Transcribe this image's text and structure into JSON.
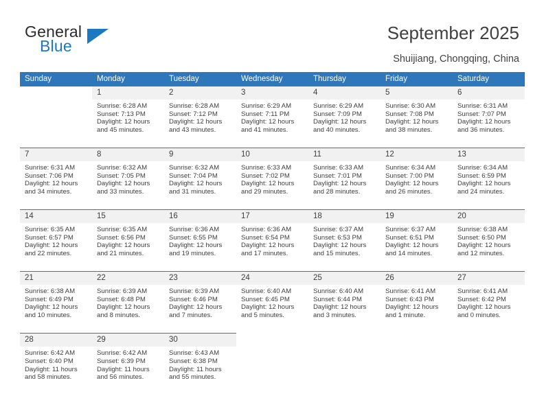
{
  "brand": {
    "name_top": "General",
    "name_bottom": "Blue"
  },
  "header": {
    "title": "September 2025",
    "subtitle": "Shuijiang, Chongqing, China"
  },
  "colors": {
    "header_blue": "#2e77bb",
    "day_band": "#f1f1f1",
    "text": "#3d3d3d"
  },
  "weekdays": [
    "Sunday",
    "Monday",
    "Tuesday",
    "Wednesday",
    "Thursday",
    "Friday",
    "Saturday"
  ],
  "labels": {
    "sunrise": "Sunrise:",
    "sunset": "Sunset:",
    "daylight": "Daylight:"
  },
  "weeks": [
    {
      "days": [
        {
          "date": "",
          "blank": true,
          "sunrise": "",
          "sunset": "",
          "daylight_1": "",
          "daylight_2": ""
        },
        {
          "date": "1",
          "sunrise": "Sunrise: 6:28 AM",
          "sunset": "Sunset: 7:13 PM",
          "daylight_1": "Daylight: 12 hours",
          "daylight_2": "and 45 minutes."
        },
        {
          "date": "2",
          "sunrise": "Sunrise: 6:28 AM",
          "sunset": "Sunset: 7:12 PM",
          "daylight_1": "Daylight: 12 hours",
          "daylight_2": "and 43 minutes."
        },
        {
          "date": "3",
          "sunrise": "Sunrise: 6:29 AM",
          "sunset": "Sunset: 7:11 PM",
          "daylight_1": "Daylight: 12 hours",
          "daylight_2": "and 41 minutes."
        },
        {
          "date": "4",
          "sunrise": "Sunrise: 6:29 AM",
          "sunset": "Sunset: 7:09 PM",
          "daylight_1": "Daylight: 12 hours",
          "daylight_2": "and 40 minutes."
        },
        {
          "date": "5",
          "sunrise": "Sunrise: 6:30 AM",
          "sunset": "Sunset: 7:08 PM",
          "daylight_1": "Daylight: 12 hours",
          "daylight_2": "and 38 minutes."
        },
        {
          "date": "6",
          "sunrise": "Sunrise: 6:31 AM",
          "sunset": "Sunset: 7:07 PM",
          "daylight_1": "Daylight: 12 hours",
          "daylight_2": "and 36 minutes."
        }
      ]
    },
    {
      "days": [
        {
          "date": "7",
          "sunrise": "Sunrise: 6:31 AM",
          "sunset": "Sunset: 7:06 PM",
          "daylight_1": "Daylight: 12 hours",
          "daylight_2": "and 34 minutes."
        },
        {
          "date": "8",
          "sunrise": "Sunrise: 6:32 AM",
          "sunset": "Sunset: 7:05 PM",
          "daylight_1": "Daylight: 12 hours",
          "daylight_2": "and 33 minutes."
        },
        {
          "date": "9",
          "sunrise": "Sunrise: 6:32 AM",
          "sunset": "Sunset: 7:04 PM",
          "daylight_1": "Daylight: 12 hours",
          "daylight_2": "and 31 minutes."
        },
        {
          "date": "10",
          "sunrise": "Sunrise: 6:33 AM",
          "sunset": "Sunset: 7:02 PM",
          "daylight_1": "Daylight: 12 hours",
          "daylight_2": "and 29 minutes."
        },
        {
          "date": "11",
          "sunrise": "Sunrise: 6:33 AM",
          "sunset": "Sunset: 7:01 PM",
          "daylight_1": "Daylight: 12 hours",
          "daylight_2": "and 28 minutes."
        },
        {
          "date": "12",
          "sunrise": "Sunrise: 6:34 AM",
          "sunset": "Sunset: 7:00 PM",
          "daylight_1": "Daylight: 12 hours",
          "daylight_2": "and 26 minutes."
        },
        {
          "date": "13",
          "sunrise": "Sunrise: 6:34 AM",
          "sunset": "Sunset: 6:59 PM",
          "daylight_1": "Daylight: 12 hours",
          "daylight_2": "and 24 minutes."
        }
      ]
    },
    {
      "days": [
        {
          "date": "14",
          "sunrise": "Sunrise: 6:35 AM",
          "sunset": "Sunset: 6:57 PM",
          "daylight_1": "Daylight: 12 hours",
          "daylight_2": "and 22 minutes."
        },
        {
          "date": "15",
          "sunrise": "Sunrise: 6:35 AM",
          "sunset": "Sunset: 6:56 PM",
          "daylight_1": "Daylight: 12 hours",
          "daylight_2": "and 21 minutes."
        },
        {
          "date": "16",
          "sunrise": "Sunrise: 6:36 AM",
          "sunset": "Sunset: 6:55 PM",
          "daylight_1": "Daylight: 12 hours",
          "daylight_2": "and 19 minutes."
        },
        {
          "date": "17",
          "sunrise": "Sunrise: 6:36 AM",
          "sunset": "Sunset: 6:54 PM",
          "daylight_1": "Daylight: 12 hours",
          "daylight_2": "and 17 minutes."
        },
        {
          "date": "18",
          "sunrise": "Sunrise: 6:37 AM",
          "sunset": "Sunset: 6:53 PM",
          "daylight_1": "Daylight: 12 hours",
          "daylight_2": "and 15 minutes."
        },
        {
          "date": "19",
          "sunrise": "Sunrise: 6:37 AM",
          "sunset": "Sunset: 6:51 PM",
          "daylight_1": "Daylight: 12 hours",
          "daylight_2": "and 14 minutes."
        },
        {
          "date": "20",
          "sunrise": "Sunrise: 6:38 AM",
          "sunset": "Sunset: 6:50 PM",
          "daylight_1": "Daylight: 12 hours",
          "daylight_2": "and 12 minutes."
        }
      ]
    },
    {
      "days": [
        {
          "date": "21",
          "sunrise": "Sunrise: 6:38 AM",
          "sunset": "Sunset: 6:49 PM",
          "daylight_1": "Daylight: 12 hours",
          "daylight_2": "and 10 minutes."
        },
        {
          "date": "22",
          "sunrise": "Sunrise: 6:39 AM",
          "sunset": "Sunset: 6:48 PM",
          "daylight_1": "Daylight: 12 hours",
          "daylight_2": "and 8 minutes."
        },
        {
          "date": "23",
          "sunrise": "Sunrise: 6:39 AM",
          "sunset": "Sunset: 6:46 PM",
          "daylight_1": "Daylight: 12 hours",
          "daylight_2": "and 7 minutes."
        },
        {
          "date": "24",
          "sunrise": "Sunrise: 6:40 AM",
          "sunset": "Sunset: 6:45 PM",
          "daylight_1": "Daylight: 12 hours",
          "daylight_2": "and 5 minutes."
        },
        {
          "date": "25",
          "sunrise": "Sunrise: 6:40 AM",
          "sunset": "Sunset: 6:44 PM",
          "daylight_1": "Daylight: 12 hours",
          "daylight_2": "and 3 minutes."
        },
        {
          "date": "26",
          "sunrise": "Sunrise: 6:41 AM",
          "sunset": "Sunset: 6:43 PM",
          "daylight_1": "Daylight: 12 hours",
          "daylight_2": "and 1 minute."
        },
        {
          "date": "27",
          "sunrise": "Sunrise: 6:41 AM",
          "sunset": "Sunset: 6:42 PM",
          "daylight_1": "Daylight: 12 hours",
          "daylight_2": "and 0 minutes."
        }
      ]
    },
    {
      "days": [
        {
          "date": "28",
          "sunrise": "Sunrise: 6:42 AM",
          "sunset": "Sunset: 6:40 PM",
          "daylight_1": "Daylight: 11 hours",
          "daylight_2": "and 58 minutes."
        },
        {
          "date": "29",
          "sunrise": "Sunrise: 6:42 AM",
          "sunset": "Sunset: 6:39 PM",
          "daylight_1": "Daylight: 11 hours",
          "daylight_2": "and 56 minutes."
        },
        {
          "date": "30",
          "sunrise": "Sunrise: 6:43 AM",
          "sunset": "Sunset: 6:38 PM",
          "daylight_1": "Daylight: 11 hours",
          "daylight_2": "and 55 minutes."
        },
        {
          "date": "",
          "blank": true,
          "sunrise": "",
          "sunset": "",
          "daylight_1": "",
          "daylight_2": ""
        },
        {
          "date": "",
          "blank": true,
          "sunrise": "",
          "sunset": "",
          "daylight_1": "",
          "daylight_2": ""
        },
        {
          "date": "",
          "blank": true,
          "sunrise": "",
          "sunset": "",
          "daylight_1": "",
          "daylight_2": ""
        },
        {
          "date": "",
          "blank": true,
          "sunrise": "",
          "sunset": "",
          "daylight_1": "",
          "daylight_2": ""
        }
      ]
    }
  ]
}
